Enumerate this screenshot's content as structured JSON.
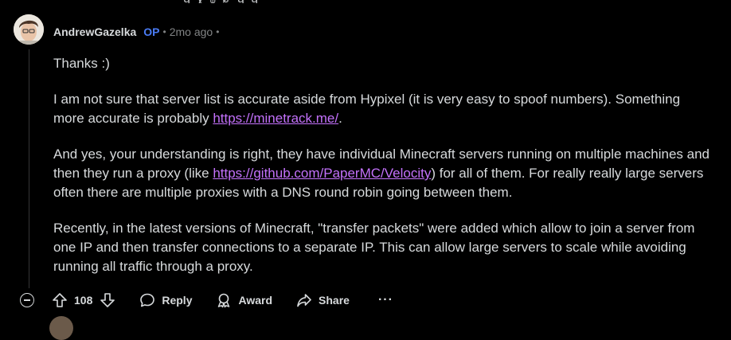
{
  "comment": {
    "author": "AndrewGazelka",
    "op_badge": "OP",
    "separator": "•",
    "time_ago": "2mo ago",
    "trailing_separator": "•",
    "paragraphs": {
      "p1": "Thanks :)",
      "p2_before": "I am not sure that server list is accurate aside from Hypixel (it is very easy to spoof numbers). Something more accurate is probably ",
      "p2_link": "https://minetrack.me/",
      "p2_after": ".",
      "p3_before": "And yes, your understanding is right, they have individual Minecraft servers running on multiple machines and then they run a proxy (like ",
      "p3_link": "https://github.com/PaperMC/Velocity",
      "p3_after": ") for all of them. For really really large servers often there are multiple proxies with a DNS round robin going between them.",
      "p4": "Recently, in the latest versions of Minecraft, \"transfer packets\" were added which allow to join a server from one IP and then transfer connections to a separate IP. This can allow large servers to scale while avoiding running all traffic through a proxy."
    }
  },
  "actions": {
    "score": "108",
    "reply": "Reply",
    "award": "Award",
    "share": "Share",
    "more": "···"
  },
  "icons": {
    "collapse": "minus-circle-icon",
    "upvote": "arrow-up-icon",
    "downvote": "arrow-down-icon",
    "reply": "speech-bubble-icon",
    "award": "award-ribbon-icon",
    "share": "share-arrow-icon",
    "more": "ellipsis-icon"
  },
  "colors": {
    "background": "#000000",
    "text": "#d7dadc",
    "muted": "#818384",
    "op_badge": "#4a7cf6",
    "link": "#c371fb"
  }
}
